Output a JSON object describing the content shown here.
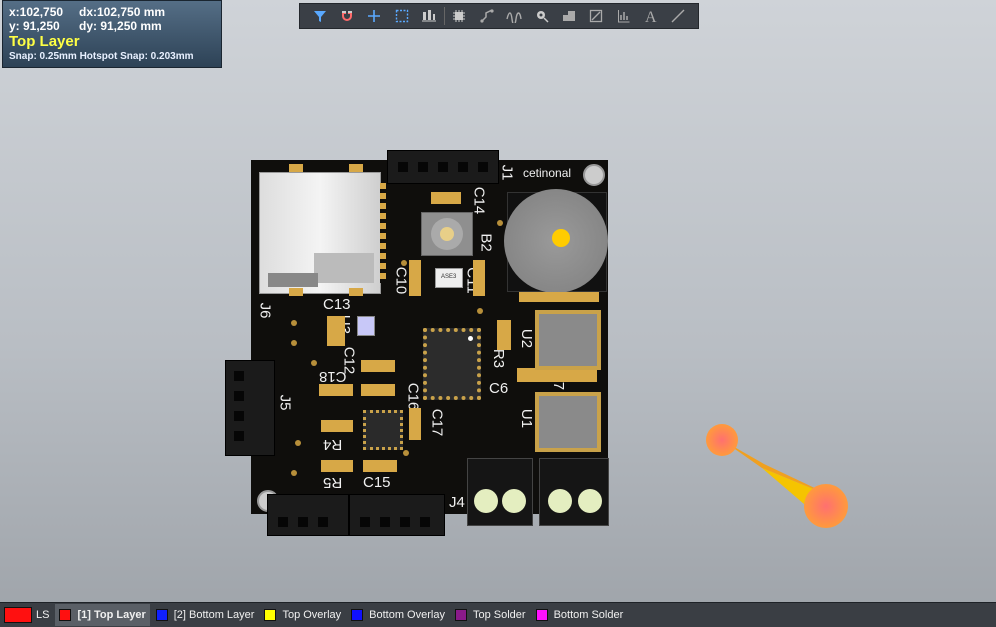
{
  "hud": {
    "x": "x:102,750",
    "dx": "dx:102,750 mm",
    "y": "y: 91,250",
    "dy": "dy: 91,250  mm",
    "layer": "Top Layer",
    "snap": "Snap: 0.25mm Hotspot Snap: 0.203mm"
  },
  "toolbar": {
    "icons": [
      "filter-icon",
      "magnet-icon",
      "cross-icon",
      "select-rect-icon",
      "align-icon",
      "component-icon",
      "route-icon",
      "interactive-route-icon",
      "via-icon",
      "polygon-icon",
      "region-icon",
      "chart-icon",
      "text-icon",
      "line-icon"
    ]
  },
  "board": {
    "logo_text": "cetinonal",
    "labels": {
      "j1": "J1",
      "j4": "J4",
      "j5": "J5",
      "j6": "J6",
      "c14": "C14",
      "b2": "B2",
      "c10": "C10",
      "c11": "C11",
      "c13": "C13",
      "u3": "U3",
      "c12": "C12",
      "c18": "C18",
      "r3": "R3",
      "c6": "C6",
      "u2": "U2",
      "c7": "C7",
      "u1": "U1",
      "c16": "C16",
      "c17": "C17",
      "r4": "R4",
      "r5": "R5",
      "c15": "C15",
      "ic_mark": "ASE3"
    }
  },
  "status": {
    "ls": "LS",
    "layers": [
      {
        "label": "[1] Top Layer",
        "color": "#ff1010",
        "active": true
      },
      {
        "label": "[2] Bottom Layer",
        "color": "#1020ff",
        "active": false
      },
      {
        "label": "Top Overlay",
        "color": "#ffff00",
        "active": false
      },
      {
        "label": "Bottom Overlay",
        "color": "#1010ff",
        "active": false
      },
      {
        "label": "Top Solder",
        "color": "#8a1a8a",
        "active": false
      },
      {
        "label": "Bottom Solder",
        "color": "#ff10ff",
        "active": false
      }
    ]
  },
  "colors": {
    "board": "#0f0e0c",
    "pad": "#d7a847",
    "silk": "#f0f0f0",
    "accent_yellow": "#ffff44"
  }
}
